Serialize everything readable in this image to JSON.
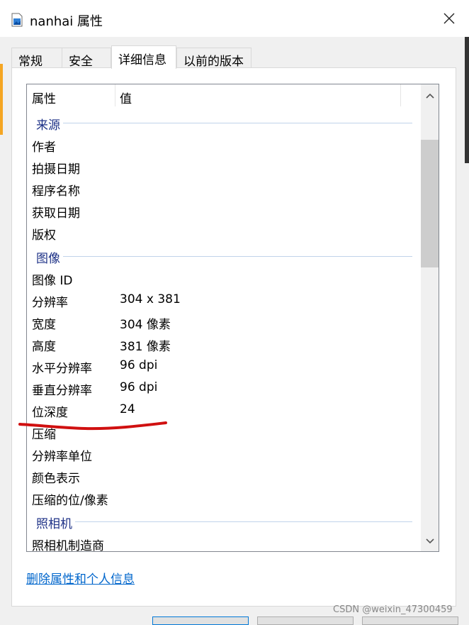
{
  "window": {
    "title": "nanhai 属性"
  },
  "tabs": [
    {
      "label": "常规"
    },
    {
      "label": "安全"
    },
    {
      "label": "详细信息"
    },
    {
      "label": "以前的版本"
    }
  ],
  "list": {
    "headers": {
      "name": "属性",
      "value": "值"
    },
    "groups": {
      "source": "来源",
      "image": "图像",
      "camera": "照相机"
    },
    "rows": {
      "author": {
        "name": "作者",
        "value": ""
      },
      "date_taken": {
        "name": "拍摄日期",
        "value": ""
      },
      "program_name": {
        "name": "程序名称",
        "value": ""
      },
      "date_acquired": {
        "name": "获取日期",
        "value": ""
      },
      "copyright": {
        "name": "版权",
        "value": ""
      },
      "image_id": {
        "name": "图像 ID",
        "value": ""
      },
      "dimensions": {
        "name": "分辨率",
        "value": "304 x 381"
      },
      "width": {
        "name": "宽度",
        "value": "304 像素"
      },
      "height": {
        "name": "高度",
        "value": "381 像素"
      },
      "h_resolution": {
        "name": "水平分辨率",
        "value": "96 dpi"
      },
      "v_resolution": {
        "name": "垂直分辨率",
        "value": "96 dpi"
      },
      "bit_depth": {
        "name": "位深度",
        "value": "24"
      },
      "compression": {
        "name": "压缩",
        "value": ""
      },
      "resolution_unit": {
        "name": "分辨率单位",
        "value": ""
      },
      "color_representation": {
        "name": "颜色表示",
        "value": ""
      },
      "compressed_bits": {
        "name": "压缩的位/像素",
        "value": ""
      },
      "camera_maker": {
        "name": "照相机制造商",
        "value": ""
      }
    }
  },
  "links": {
    "remove_properties": "删除属性和个人信息"
  },
  "watermark": "CSDN @weixin_47300459",
  "colors": {
    "accent_link": "#0066cc",
    "group_label": "#1e3287",
    "annotation_red": "#d01010"
  },
  "icons": {
    "app": "image-file-icon",
    "close": "close-icon",
    "scroll_up": "chevron-up-icon",
    "scroll_down": "chevron-down-icon"
  }
}
